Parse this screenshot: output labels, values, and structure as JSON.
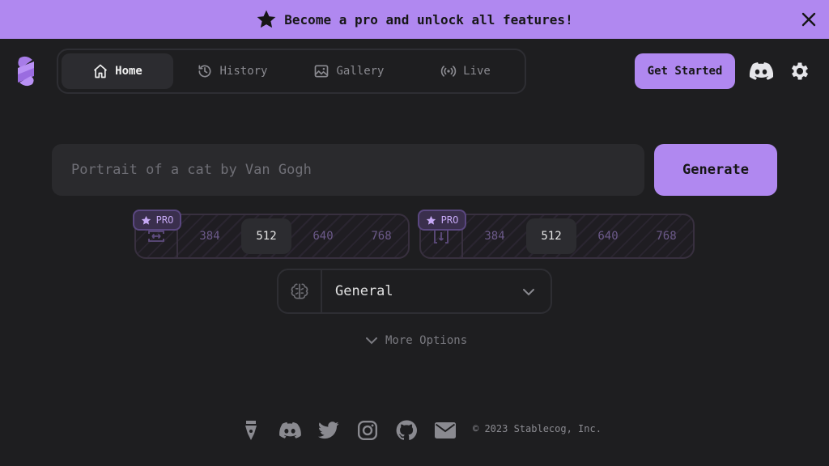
{
  "banner": {
    "text": "Become a pro and unlock all features!"
  },
  "nav": {
    "tabs": [
      {
        "label": "Home",
        "icon": "home-icon"
      },
      {
        "label": "History",
        "icon": "history-icon"
      },
      {
        "label": "Gallery",
        "icon": "image-icon"
      },
      {
        "label": "Live",
        "icon": "broadcast-icon"
      }
    ],
    "cta": "Get Started"
  },
  "prompt": {
    "placeholder": "Portrait of a cat by Van Gogh",
    "button": "Generate"
  },
  "width_selector": {
    "badge": "PRO",
    "options": [
      "384",
      "512",
      "640",
      "768"
    ],
    "selected": "512"
  },
  "height_selector": {
    "badge": "PRO",
    "options": [
      "384",
      "512",
      "640",
      "768"
    ],
    "selected": "512"
  },
  "model": {
    "value": "General"
  },
  "more_options": "More Options",
  "footer": {
    "copyright": "© 2023 Stablecog, Inc."
  },
  "colors": {
    "accent": "#b088f0",
    "background": "#1e1e20",
    "surface": "#2a2a2d"
  }
}
